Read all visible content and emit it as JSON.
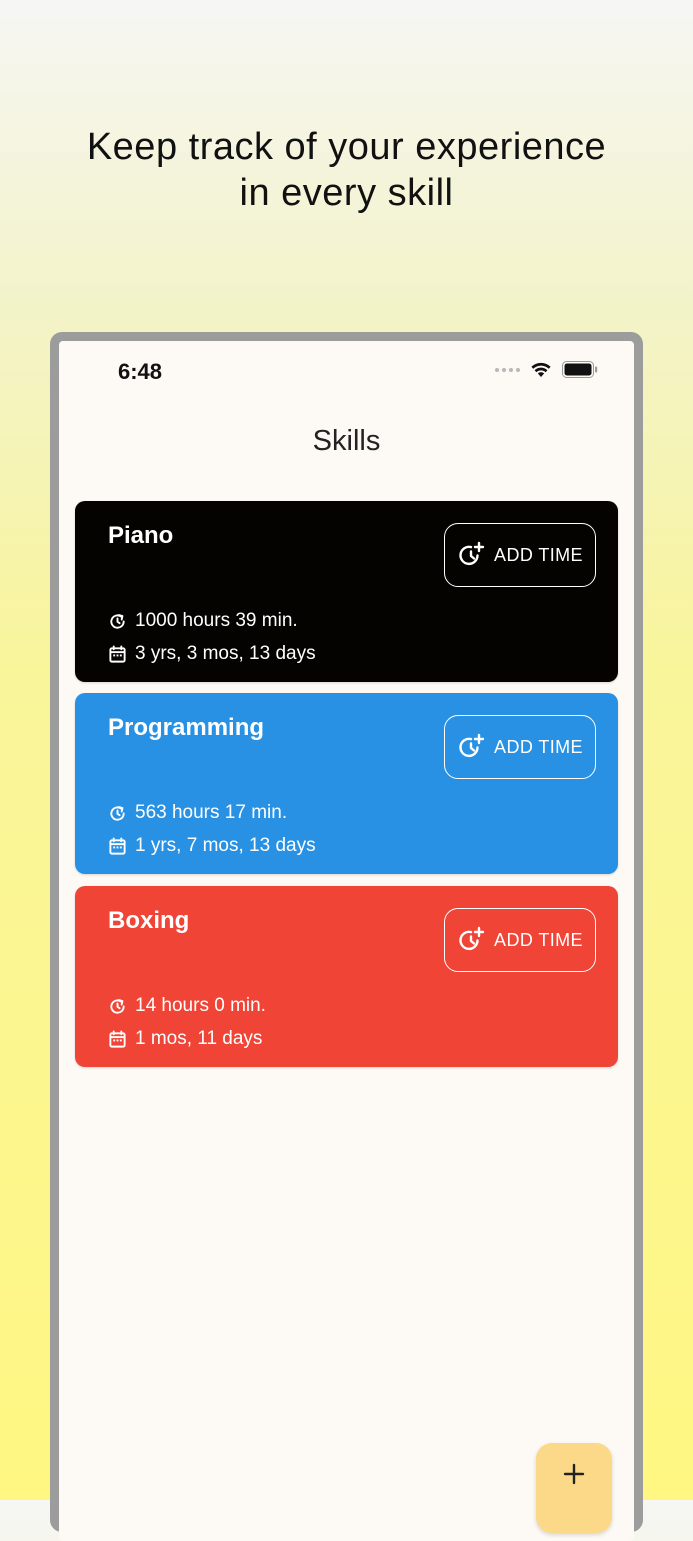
{
  "headline": {
    "line1": "Keep track of your experience",
    "line2": "in every skill"
  },
  "status_bar": {
    "time": "6:48",
    "icons": [
      "signal-dots-icon",
      "wifi-icon",
      "battery-icon"
    ]
  },
  "screen": {
    "title": "Skills"
  },
  "skills": [
    {
      "name": "Piano",
      "color": "#050300",
      "add_label": "ADD TIME",
      "hours": "1000 hours 39 min.",
      "duration": "3 yrs, 3 mos, 13 days"
    },
    {
      "name": "Programming",
      "color": "#2891e4",
      "add_label": "ADD TIME",
      "hours": "563 hours 17 min.",
      "duration": "1 yrs, 7 mos, 13 days"
    },
    {
      "name": "Boxing",
      "color": "#ef4436",
      "add_label": "ADD TIME",
      "hours": "14 hours 0 min.",
      "duration": "1 mos, 11 days"
    }
  ],
  "fab": {
    "icon": "plus-icon",
    "color": "#fcd989"
  },
  "colors": {
    "screen_background": "#fdf9f5",
    "frame": "#9c9c9c"
  }
}
